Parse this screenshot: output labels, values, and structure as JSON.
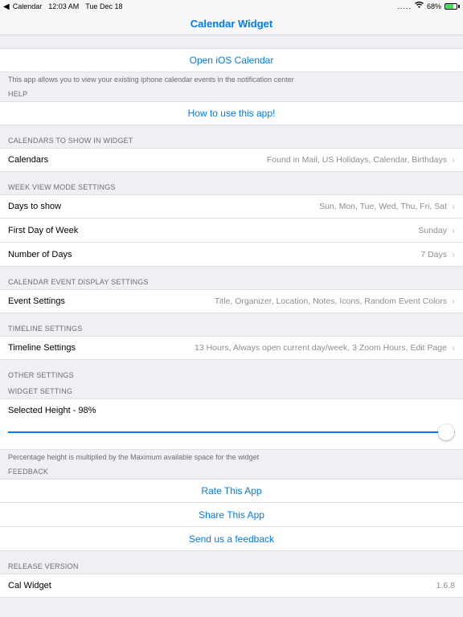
{
  "status": {
    "back_app": "Calendar",
    "time": "12:03 AM",
    "date": "Tue Dec 18",
    "battery_pct": "68%"
  },
  "nav": {
    "title": "Calendar Widget"
  },
  "open_calendar": "Open iOS Calendar",
  "app_description": "This app allows you to view your existing iphone calendar events in the notification center",
  "help_header": "HELP",
  "how_to_use": "How to use this app!",
  "calendars_header": "CALENDARS TO SHOW IN WIDGET",
  "calendars_row": {
    "label": "Calendars",
    "value": "Found in Mail, US Holidays, Calendar, Birthdays"
  },
  "week_header": "WEEK VIEW MODE SETTINGS",
  "days_to_show": {
    "label": "Days to show",
    "value": "Sun, Mon, Tue, Wed, Thu, Fri, Sat"
  },
  "first_day": {
    "label": "First Day of Week",
    "value": "Sunday"
  },
  "num_days": {
    "label": "Number of Days",
    "value": "7 Days"
  },
  "event_header": "CALENDAR EVENT DISPLAY SETTINGS",
  "event_settings": {
    "label": "Event Settings",
    "value": "Title, Organizer, Location, Notes, Icons, Random Event Colors"
  },
  "timeline_header": "TIMELINE SETTINGS",
  "timeline_settings": {
    "label": "Timeline Settings",
    "value": "13 Hours, Always open current day/week, 3 Zoom Hours, Edit Page"
  },
  "other_header": "OTHER SETTINGS",
  "widget_setting_header": "WIDGET SETTING",
  "slider": {
    "label": "Selected Height - 98%",
    "percent": 98
  },
  "slider_footer": "Percentage height is multiplied by the Maximum available space for the widget",
  "feedback_header": "FEEDBACK",
  "feedback": {
    "rate": "Rate This App",
    "share": "Share This App",
    "send": "Send us a feedback"
  },
  "release_header": "RELEASE VERSION",
  "release": {
    "label": "Cal Widget",
    "value": "1.6.8"
  }
}
